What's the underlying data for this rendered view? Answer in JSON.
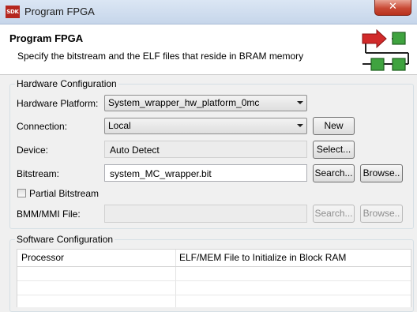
{
  "window": {
    "icon_text": "SDK",
    "title": "Program FPGA",
    "close_glyph": "✕"
  },
  "header": {
    "title": "Program FPGA",
    "description": "Specify the bitstream and the ELF files that reside in BRAM memory",
    "graphic_icon": "fpga-program-icon",
    "colors": {
      "arrow": "#d12a2a",
      "block": "#3fa33f"
    }
  },
  "hardware": {
    "group_label": "Hardware Configuration",
    "platform": {
      "label": "Hardware Platform:",
      "value": "System_wrapper_hw_platform_0mc"
    },
    "connection": {
      "label": "Connection:",
      "value": "Local",
      "new_button": "New"
    },
    "device": {
      "label": "Device:",
      "value": "Auto Detect",
      "select_button": "Select..."
    },
    "bitstream": {
      "label": "Bitstream:",
      "value": "system_MC_wrapper.bit",
      "search_button": "Search...",
      "browse_button": "Browse.."
    },
    "partial": {
      "label": "Partial Bitstream",
      "checked": false
    },
    "bmm": {
      "label": "BMM/MMI File:",
      "value": "",
      "search_button": "Search...",
      "browse_button": "Browse.."
    }
  },
  "software": {
    "group_label": "Software Configuration",
    "columns": [
      "Processor",
      "ELF/MEM File to Initialize in Block RAM"
    ]
  }
}
